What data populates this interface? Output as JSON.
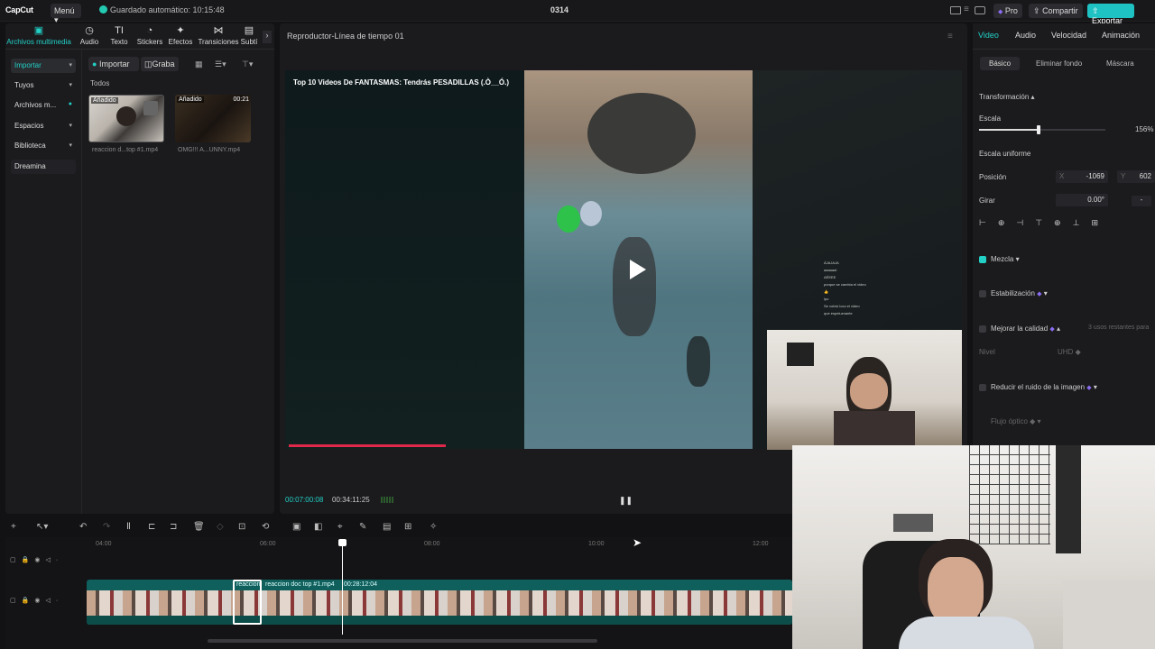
{
  "topbar": {
    "logo": "CapCut",
    "menu": "Menú",
    "autosave": "Guardado automático: 10:15:48",
    "project": "0314",
    "pro": "Pro",
    "share": "Compartir",
    "export": "Exportar"
  },
  "tools": [
    {
      "label": "Archivos multimedia",
      "icon": "▣"
    },
    {
      "label": "Audio",
      "icon": "◷"
    },
    {
      "label": "Texto",
      "icon": "TI"
    },
    {
      "label": "Stickers",
      "icon": "◔"
    },
    {
      "label": "Efectos",
      "icon": "✦"
    },
    {
      "label": "Transiciones",
      "icon": "⋈"
    },
    {
      "label": "Subtí",
      "icon": "▤"
    }
  ],
  "sidenav": [
    "Importar",
    "Tuyos",
    "Archivos m...",
    "Espacios",
    "Biblioteca",
    "Dreamina"
  ],
  "media": {
    "import_btn": "Importar",
    "record_btn": "Graba",
    "filter_all": "Todos",
    "items": [
      {
        "badge": "Añadido",
        "duration": "",
        "name": "reaccion d...top #1.mp4"
      },
      {
        "badge": "Añadido",
        "duration": "00:21",
        "name": "OMG!!! A...UNNY.mp4"
      }
    ]
  },
  "player": {
    "title": "Reproductor-Línea de tiempo 01",
    "video_title": "Top 10 Videos De FANTASMAS: Tendrás PESADILLAS (.Ò__Ó.)",
    "current_time": "00:07:00:08",
    "total_time": "00:34:11:25",
    "chat": [
      "ÁJAJAJA",
      "aaaaaa!",
      "AÉEEE",
      "porque se cambia el video",
      "👍",
      "lpo",
      "Se volvió loco el video",
      "que espeluznante"
    ]
  },
  "rightpanel": {
    "tabs": [
      "Video",
      "Audio",
      "Velocidad",
      "Animación"
    ],
    "subtabs": [
      "Básico",
      "Eliminar fondo",
      "Máscara"
    ],
    "transform": "Transformación",
    "scale_label": "Escala",
    "scale_value": "156%",
    "scale_fraction": 0.47,
    "uniform": "Escala uniforme",
    "position_label": "Posición",
    "pos_x_label": "X",
    "pos_x": "-1069",
    "pos_y_label": "Y",
    "pos_y": "602",
    "rotate_label": "Girar",
    "rotate_value": "0.00°",
    "blend": "Mezcla",
    "stabilize": "Estabilización",
    "enhance": "Mejorar la calidad",
    "enhance_note": "3 usos restantes para",
    "level_label": "Nivel",
    "level_value": "UHD",
    "denoise": "Reducir el ruido de la imagen",
    "flow": "Flujo óptico"
  },
  "timeline": {
    "ruler": [
      "04:00",
      "06:00",
      "08:00",
      "10:00",
      "12:00"
    ],
    "clip_label_a": "reaccion",
    "clip_label_b": "reaccion doc top #1.mp4",
    "clip_duration": "00:28:12:04"
  }
}
